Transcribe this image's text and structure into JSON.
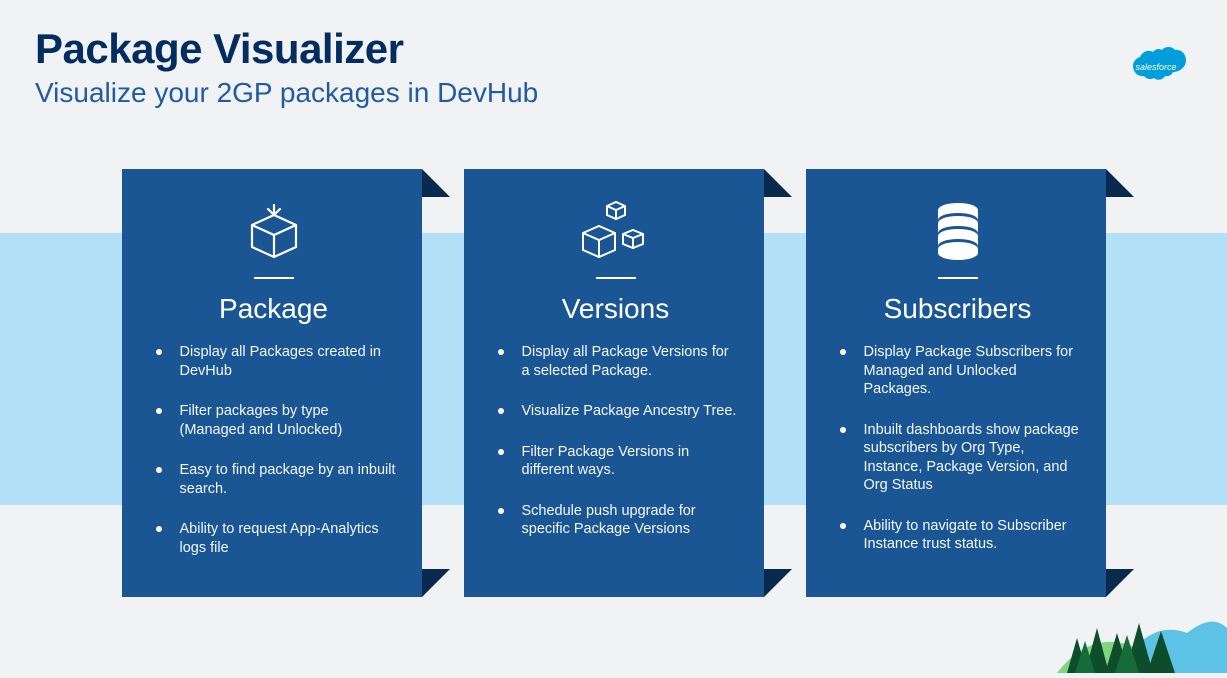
{
  "header": {
    "title": "Package Visualizer",
    "subtitle": "Visualize your 2GP packages in DevHub"
  },
  "logo": {
    "name": "salesforce"
  },
  "cards": [
    {
      "icon": "package-icon",
      "title": "Package",
      "bullets": [
        "Display all Packages created in DevHub",
        "Filter packages by type (Managed and Unlocked)",
        "Easy to find package by an inbuilt search.",
        "Ability to request App-Analytics logs file"
      ]
    },
    {
      "icon": "versions-icon",
      "title": "Versions",
      "bullets": [
        "Display all Package Versions for a selected Package.",
        "Visualize Package Ancestry Tree.",
        "Filter Package Versions in different ways.",
        "Schedule push upgrade for specific Package Versions"
      ]
    },
    {
      "icon": "subscribers-icon",
      "title": "Subscribers",
      "bullets": [
        "Display Package Subscribers for Managed and Unlocked Packages.",
        "Inbuilt dashboards show package subscribers by Org Type, Instance, Package Version, and Org Status",
        "Ability to navigate to Subscriber Instance trust status."
      ]
    }
  ]
}
